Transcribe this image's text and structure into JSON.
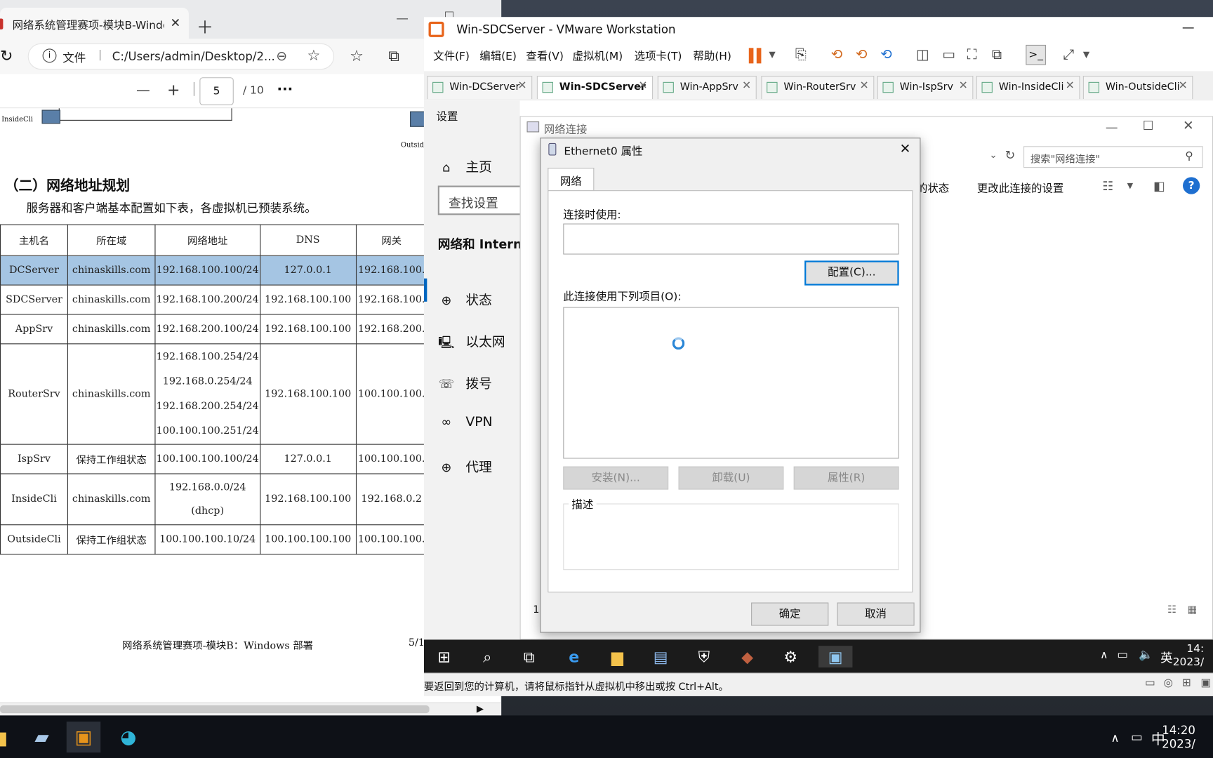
{
  "edge": {
    "tab_title": "网络系统管理赛项-模块B-Windo",
    "address_prefix": "文件",
    "address_url": "C:/Users/admin/Desktop/2...",
    "pdf_page": "5",
    "pdf_total": "/ 10",
    "more": "···",
    "minus": "—",
    "plus": "+"
  },
  "pdf": {
    "diagram_label_left": "InsideCli",
    "diagram_label_right": "Outsid",
    "section_title": "（二）网络地址规划",
    "intro": "服务器和客户端基本配置如下表，各虚拟机已预装系统。",
    "table_headers": [
      "主机名",
      "所在域",
      "网络地址",
      "DNS",
      "网关"
    ],
    "rows": [
      {
        "host": "DCServer",
        "domain": "chinaskills.com",
        "addr": [
          "192.168.100.100/24"
        ],
        "dns": "127.0.0.1",
        "gw": "192.168.100."
      },
      {
        "host": "SDCServer",
        "domain": "chinaskills.com",
        "addr": [
          "192.168.100.200/24"
        ],
        "dns": "192.168.100.100",
        "gw": "192.168.100."
      },
      {
        "host": "AppSrv",
        "domain": "chinaskills.com",
        "addr": [
          "192.168.200.100/24"
        ],
        "dns": "192.168.100.100",
        "gw": "192.168.200."
      },
      {
        "host": "RouterSrv",
        "domain": "chinaskills.com",
        "addr": [
          "192.168.100.254/24",
          "192.168.0.254/24",
          "192.168.200.254/24",
          "100.100.100.251/24"
        ],
        "dns": "192.168.100.100",
        "gw": "100.100.100."
      },
      {
        "host": "IspSrv",
        "domain": "保持工作组状态",
        "addr": [
          "100.100.100.100/24"
        ],
        "dns": "127.0.0.1",
        "gw": "100.100.100."
      },
      {
        "host": "InsideCli",
        "domain": "chinaskills.com",
        "addr": [
          "192.168.0.0/24",
          "(dhcp)"
        ],
        "dns": "192.168.100.100",
        "gw": "192.168.0.2"
      },
      {
        "host": "OutsideCli",
        "domain": "保持工作组状态",
        "addr": [
          "100.100.100.10/24"
        ],
        "dns": "100.100.100.100",
        "gw": "100.100.100."
      }
    ],
    "footer": "网络系统管理赛项-模块B：Windows 部署",
    "footer_page": "5/1"
  },
  "vmware": {
    "title": "Win-SDCServer - VMware Workstation",
    "menu": [
      "文件(F)",
      "编辑(E)",
      "查看(V)",
      "虚拟机(M)",
      "选项卡(T)",
      "帮助(H)"
    ],
    "tabs": [
      "Win-DCServer",
      "Win-SDCServer",
      "Win-AppSrv",
      "Win-RouterSrv",
      "Win-IspSrv",
      "Win-InsideCli",
      "Win-OutsideCli"
    ],
    "status_text": "要返回到您的计算机，请将鼠标指针从虚拟机中移出或按 Ctrl+Alt。"
  },
  "settings": {
    "title": "设置",
    "home": "主页",
    "search_placeholder": "查找设置",
    "section": "网络和 Interne",
    "nav": [
      "状态",
      "以太网",
      "拨号",
      "VPN",
      "代理"
    ]
  },
  "netconn": {
    "title": "网络连接",
    "search_placeholder": "搜索\"网络连接\"",
    "cmd_status": "的状态",
    "cmd_change": "更改此连接的设置",
    "help": "?",
    "left_digit": "1"
  },
  "dialog": {
    "title": "Ethernet0 属性",
    "close": "✕",
    "tab": "网络",
    "connect_using": "连接时使用:",
    "configure": "配置(C)...",
    "items_label": "此连接使用下列项目(O):",
    "install": "安装(N)...",
    "uninstall": "卸载(U)",
    "properties": "属性(R)",
    "description": "描述",
    "ok": "确定",
    "cancel": "取消"
  },
  "guest_taskbar": {
    "lang": "英",
    "time": "14:",
    "date": "2023/"
  },
  "host_taskbar": {
    "lang": "中",
    "time": "14:20",
    "date": "2023/"
  },
  "colors": {
    "accent": "#0078d7",
    "highlight_row": "#a5c5e3",
    "vm_pause": "#e8641b"
  }
}
